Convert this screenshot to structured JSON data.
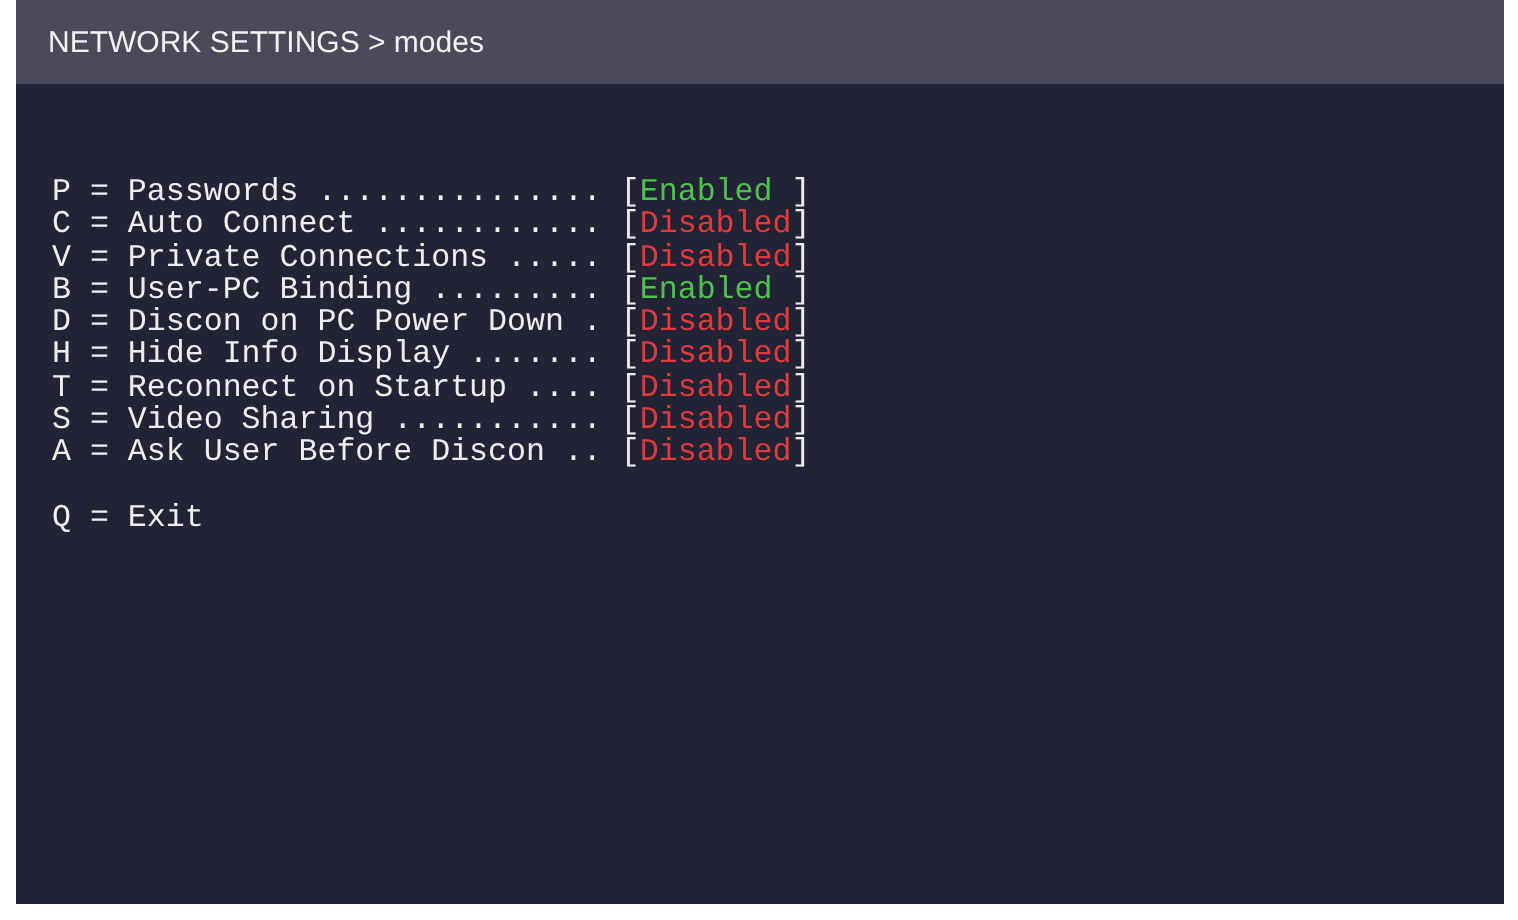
{
  "header": {
    "title": "NETWORK SETTINGS > modes"
  },
  "options": [
    {
      "key": "P",
      "separator": "=",
      "label": "Passwords ...............",
      "open": "[",
      "status": "Enabled",
      "close": "]",
      "enabled": true
    },
    {
      "key": "C",
      "separator": "=",
      "label": "Auto Connect ............",
      "open": "[",
      "status": "Disabled",
      "close": "]",
      "enabled": false
    },
    {
      "key": "V",
      "separator": "=",
      "label": "Private Connections .....",
      "open": "[",
      "status": "Disabled",
      "close": "]",
      "enabled": false
    },
    {
      "key": "B",
      "separator": "=",
      "label": "User-PC Binding .........",
      "open": "[",
      "status": "Enabled",
      "close": "]",
      "enabled": true
    },
    {
      "key": "D",
      "separator": "=",
      "label": "Discon on PC Power Down .",
      "open": "[",
      "status": "Disabled",
      "close": "]",
      "enabled": false
    },
    {
      "key": "H",
      "separator": "=",
      "label": "Hide Info Display .......",
      "open": "[",
      "status": "Disabled",
      "close": "]",
      "enabled": false
    },
    {
      "key": "T",
      "separator": "=",
      "label": "Reconnect on Startup ....",
      "open": "[",
      "status": "Disabled",
      "close": "]",
      "enabled": false
    },
    {
      "key": "S",
      "separator": "=",
      "label": "Video Sharing ...........",
      "open": "[",
      "status": "Disabled",
      "close": "]",
      "enabled": false
    },
    {
      "key": "A",
      "separator": "=",
      "label": "Ask User Before Discon ..",
      "open": "[",
      "status": "Disabled",
      "close": "]",
      "enabled": false
    }
  ],
  "exit": {
    "key": "Q",
    "separator": "=",
    "label": "Exit"
  }
}
